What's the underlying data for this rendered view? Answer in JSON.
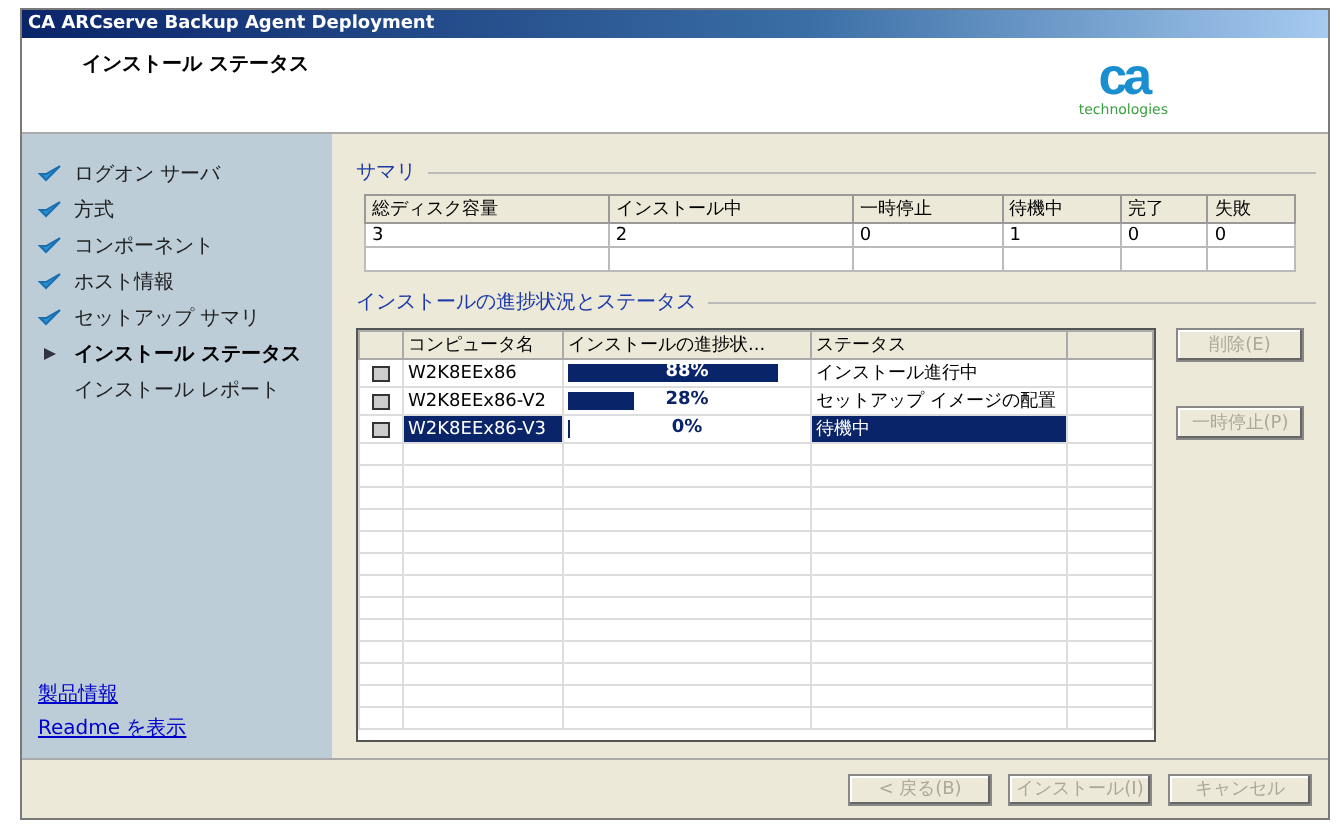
{
  "window": {
    "title": "CA ARCserve Backup Agent Deployment"
  },
  "header": {
    "title": "インストール ステータス",
    "logo_text": "ca",
    "logo_sub": "technologies"
  },
  "sidebar": {
    "steps": [
      {
        "label": "ログオン サーバ",
        "kind": "done"
      },
      {
        "label": "方式",
        "kind": "done"
      },
      {
        "label": "コンポーネント",
        "kind": "done"
      },
      {
        "label": "ホスト情報",
        "kind": "done"
      },
      {
        "label": "セットアップ サマリ",
        "kind": "done"
      },
      {
        "label": "インストール ステータス",
        "kind": "current"
      },
      {
        "label": "インストール レポート",
        "kind": "pending"
      }
    ],
    "links": [
      "製品情報",
      "Readme を表示"
    ]
  },
  "summary": {
    "title": "サマリ",
    "columns": [
      "総ディスク容量",
      "インストール中",
      "一時停止",
      "待機中",
      "完了",
      "失敗"
    ],
    "values": [
      "3",
      "2",
      "0",
      "1",
      "0",
      "0"
    ]
  },
  "progress": {
    "title": "インストールの進捗状況とステータス",
    "columns": [
      "コンピュータ名",
      "インストールの進捗状...",
      "ステータス"
    ],
    "rows": [
      {
        "computer": "W2K8EEx86",
        "level": 0.88,
        "percent": "88%",
        "status": "インストール進行中",
        "selected": false
      },
      {
        "computer": "W2K8EEx86-V2",
        "level": 0.28,
        "percent": "28%",
        "status": "セットアップ イメージの配置",
        "selected": false
      },
      {
        "computer": "W2K8EEx86-V3",
        "level": 0,
        "percent": "0%",
        "status": "待機中",
        "selected": true
      }
    ],
    "buttons": [
      {
        "label": "削除(E)",
        "disabled": true
      },
      {
        "label": "一時停止(P)",
        "disabled": true
      }
    ]
  },
  "footer": {
    "buttons": [
      {
        "label": "< 戻る(B)",
        "disabled": true
      },
      {
        "label": "インストール(I)",
        "disabled": true
      },
      {
        "label": "キャンセル",
        "disabled": true
      }
    ]
  }
}
